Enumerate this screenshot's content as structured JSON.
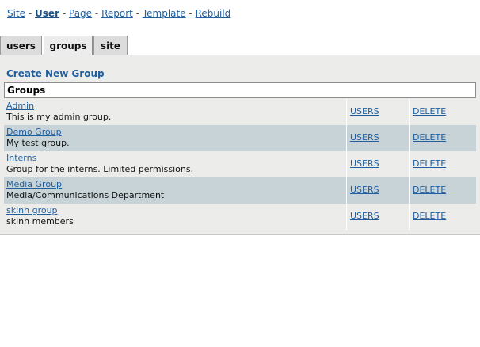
{
  "breadcrumb": {
    "items": [
      "Site",
      "User",
      "Page",
      "Report",
      "Template",
      "Rebuild"
    ],
    "separator": "-",
    "active": "User"
  },
  "tabs": [
    {
      "label": "users"
    },
    {
      "label": "groups",
      "active": true
    },
    {
      "label": "site"
    }
  ],
  "actions": {
    "create_label": "Create New Group"
  },
  "groups_table": {
    "header": "Groups",
    "users_label": "USERS",
    "delete_label": "DELETE",
    "rows": [
      {
        "name": "Admin",
        "description": "This is my admin group."
      },
      {
        "name": "Demo Group",
        "description": "My test group."
      },
      {
        "name": "Interns",
        "description": "Group for the interns. Limited permissions."
      },
      {
        "name": "Media Group",
        "description": "Media/Communications Department"
      },
      {
        "name": "skinh group",
        "description": "skinh members"
      }
    ]
  },
  "colors": {
    "link": "#1f5fa0",
    "panel_bg": "#ececeb",
    "row_alt_bg": "#c7d3d7"
  }
}
